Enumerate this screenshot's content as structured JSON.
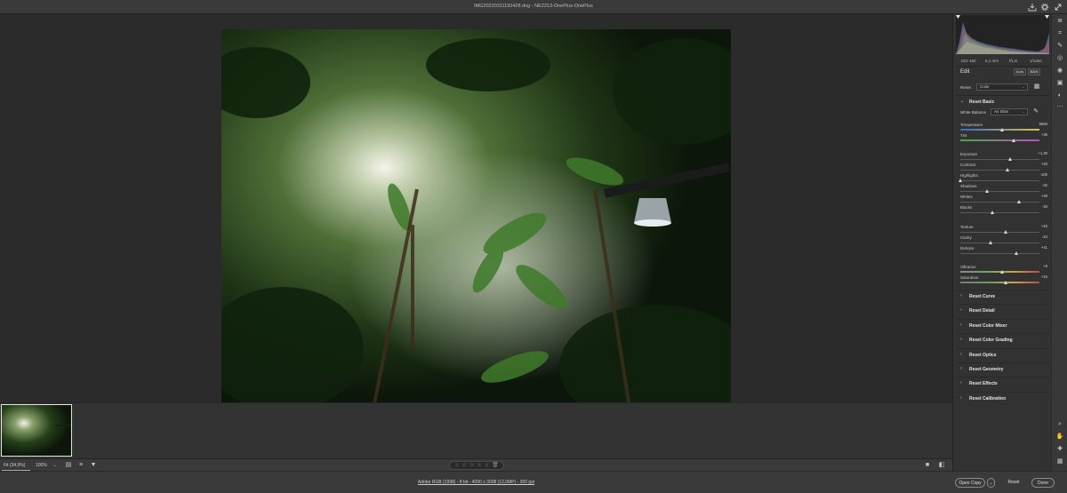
{
  "window": {
    "title": "IMG20220311150428.dng  -  NE2213-OnePlus-OnePlus"
  },
  "bottombar": {
    "fit_label": "Fit (34,9%)",
    "zoom_label": "100%",
    "rating_stars": 0
  },
  "status": {
    "file_info": "Adobe RGB (1998) - 8 bit - 4000 x 3008 (12,0MP) - 300 ppi",
    "open_copy": "Open Copy",
    "reset": "Reset",
    "done": "Done"
  },
  "exif": {
    "iso": "ISO 100",
    "focal": "6,1 mm",
    "aperture": "f/1,8",
    "shutter": "1/125s"
  },
  "edit": {
    "title": "Edit",
    "auto": "Auto",
    "bw": "B&W",
    "profile_label": "Reset",
    "profile_value": "Color"
  },
  "basic": {
    "title": "Reset Basic",
    "white_balance_label": "White Balance",
    "white_balance_value": "As Shot",
    "sliders": [
      {
        "name": "Temperature",
        "value": "5650",
        "pos": 0.53,
        "kind": "temp"
      },
      {
        "name": "Tint",
        "value": "+35",
        "pos": 0.67,
        "kind": "tint"
      },
      {
        "name": "Exposure",
        "value": "+1.30",
        "pos": 0.63,
        "kind": "plain"
      },
      {
        "name": "Contrast",
        "value": "+20",
        "pos": 0.6,
        "kind": "plain"
      },
      {
        "name": "Highlights",
        "value": "-100",
        "pos": 0.0,
        "kind": "plain"
      },
      {
        "name": "Shadows",
        "value": "-32",
        "pos": 0.34,
        "kind": "plain"
      },
      {
        "name": "Whites",
        "value": "+49",
        "pos": 0.745,
        "kind": "plain"
      },
      {
        "name": "Blacks",
        "value": "-20",
        "pos": 0.4,
        "kind": "plain"
      },
      {
        "name": "Texture",
        "value": "+15",
        "pos": 0.575,
        "kind": "plain"
      },
      {
        "name": "Clarity",
        "value": "-24",
        "pos": 0.38,
        "kind": "plain"
      },
      {
        "name": "Dehaze",
        "value": "+41",
        "pos": 0.705,
        "kind": "plain"
      },
      {
        "name": "Vibrance",
        "value": "+6",
        "pos": 0.53,
        "kind": "vib"
      },
      {
        "name": "Saturation",
        "value": "+15",
        "pos": 0.575,
        "kind": "sat"
      }
    ]
  },
  "sections": [
    "Reset Curve",
    "Reset Detail",
    "Reset Color Mixer",
    "Reset Color Grading",
    "Reset Optics",
    "Reset Geometry",
    "Reset Effects",
    "Reset Calibration"
  ],
  "icons": {
    "titlebar": [
      "save-icon",
      "gear-icon",
      "expand-icon"
    ],
    "toolrail": [
      "edit-icon",
      "crop-icon",
      "healing-icon",
      "masking-icon",
      "redeye-icon",
      "presets-icon",
      "snapshots-icon",
      "more-icon",
      "zoom-icon",
      "hand-icon",
      "sampler-icon",
      "grid-icon"
    ]
  },
  "colors": {
    "panel_bg": "#323232",
    "accent": "#ffffff"
  }
}
